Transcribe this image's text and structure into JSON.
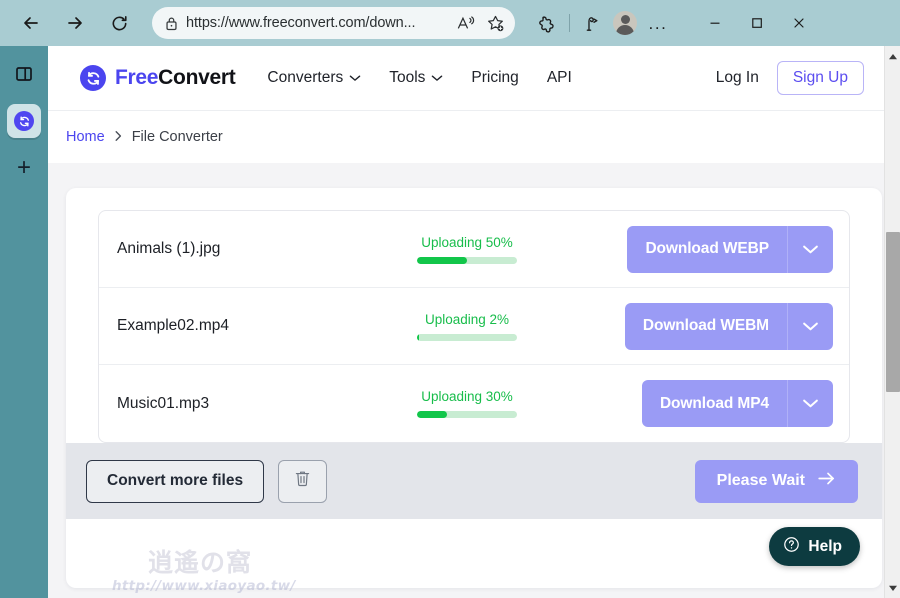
{
  "browser": {
    "back_label": "Back",
    "forward_label": "Forward",
    "reload_label": "Refresh",
    "url": "https://www.freeconvert.com/down...",
    "lock_icon": "lock-icon",
    "read_aloud_icon": "read-aloud-icon",
    "favorites_icon": "add-favorite-star-icon",
    "extensions_icon": "browser-essentials-icon",
    "split_screen_icon": "split-screen-icon",
    "profile_icon": "profile-avatar-icon",
    "settings_more_label": "...",
    "minimize_label": "–",
    "maximize_label": "□",
    "close_label": "✕"
  },
  "sidebar": {
    "items": [
      {
        "name": "toggle-sidebar",
        "icon": "panel-layout-icon"
      },
      {
        "name": "active-tab",
        "icon": "freeconvert-favicon"
      },
      {
        "name": "new-tab",
        "icon": "plus-icon",
        "label": "+"
      }
    ]
  },
  "site_header": {
    "brand": {
      "free": "Free",
      "convert": "Convert",
      "mark_color": "#4b45ef"
    },
    "nav": [
      {
        "label": "Converters",
        "has_caret": true
      },
      {
        "label": "Tools",
        "has_caret": true
      },
      {
        "label": "Pricing",
        "has_caret": false
      },
      {
        "label": "API",
        "has_caret": false
      }
    ],
    "login_label": "Log In",
    "signup_label": "Sign Up",
    "accent_color": "#4b45ef"
  },
  "breadcrumb": {
    "home": "Home",
    "separator": "›",
    "current": "File Converter"
  },
  "files": [
    {
      "name": "Animals (1).jpg",
      "status": "Uploading 50%",
      "percent": 50,
      "download_label": "Download WEBP",
      "caret_icon": "chevron-down-icon"
    },
    {
      "name": "Example02.mp4",
      "status": "Uploading 2%",
      "percent": 2,
      "download_label": "Download WEBM",
      "caret_icon": "chevron-down-icon"
    },
    {
      "name": "Music01.mp3",
      "status": "Uploading 30%",
      "percent": 30,
      "download_label": "Download MP4",
      "caret_icon": "chevron-down-icon"
    }
  ],
  "action_bar": {
    "convert_more_label": "Convert more files",
    "delete_icon": "trash-icon",
    "primary_label": "Please Wait",
    "primary_arrow_icon": "arrow-right-icon"
  },
  "help": {
    "label": "Help",
    "icon": "question-mark-circle-icon",
    "color": "#0d3b40"
  },
  "watermark": {
    "cjk": "逍遙の窩",
    "url": "http://www.xiaoyao.tw/"
  },
  "colors": {
    "progress_green": "#12c64a",
    "progress_track": "#c8ecd2",
    "button_purple": "#9a9bf5",
    "browser_chrome": "#a9ccd2",
    "sidebar": "#52939e",
    "page_backdrop": "#f4f4f6",
    "action_bar": "#e3e5ea"
  }
}
